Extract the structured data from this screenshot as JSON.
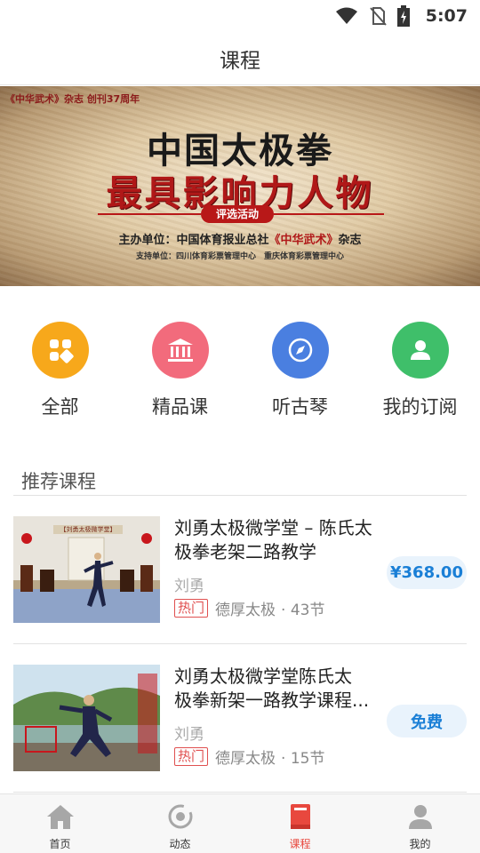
{
  "status_bar": {
    "time": "5:07",
    "icons": [
      "wifi-icon",
      "no-sim-icon",
      "battery-charging-icon"
    ]
  },
  "header": {
    "title": "课程"
  },
  "banner": {
    "top_text": "《中华武术》杂志 创刊37周年",
    "title_line1": "中国太极拳",
    "title_line2": "最具影响力人物",
    "badge": "评选活动",
    "host_prefix": "主办单位：中国体育报业总社",
    "host_magazine": "《中华武术》",
    "host_suffix": "杂志",
    "support": "支持单位：四川体育彩票管理中心　重庆体育彩票管理中心"
  },
  "categories": [
    {
      "label": "全部",
      "icon": "grid-icon",
      "color": "#f7a81b"
    },
    {
      "label": "精品课",
      "icon": "bank-icon",
      "color": "#f26b7c"
    },
    {
      "label": "听古琴",
      "icon": "compass-icon",
      "color": "#4a7fe0"
    },
    {
      "label": "我的订阅",
      "icon": "user-icon",
      "color": "#3fbf6a"
    }
  ],
  "section": {
    "title": "推荐课程"
  },
  "courses": [
    {
      "title_line1": "刘勇太极微学堂 – 陈氏太",
      "title_line2": "极拳老架二路教学",
      "author": "刘勇",
      "tag": "热门",
      "school": "德厚太极",
      "lessons": "· 43节",
      "price": "¥368.00",
      "thumb_banner": "【刘勇太极微学堂】"
    },
    {
      "title_line1": "刘勇太极微学堂陈氏太",
      "title_line2": "极拳新架一路教学课程...",
      "author": "刘勇",
      "tag": "热门",
      "school": "德厚太极",
      "lessons": "· 15节",
      "price": "免费"
    }
  ],
  "bottom_nav": [
    {
      "label": "首页",
      "icon": "home-icon"
    },
    {
      "label": "动态",
      "icon": "activity-icon"
    },
    {
      "label": "课程",
      "icon": "book-icon",
      "active": true
    },
    {
      "label": "我的",
      "icon": "profile-icon"
    }
  ],
  "colors": {
    "accent_blue": "#1a7fd6",
    "nav_active": "#e8483e",
    "hot_tag": "#e05050"
  }
}
